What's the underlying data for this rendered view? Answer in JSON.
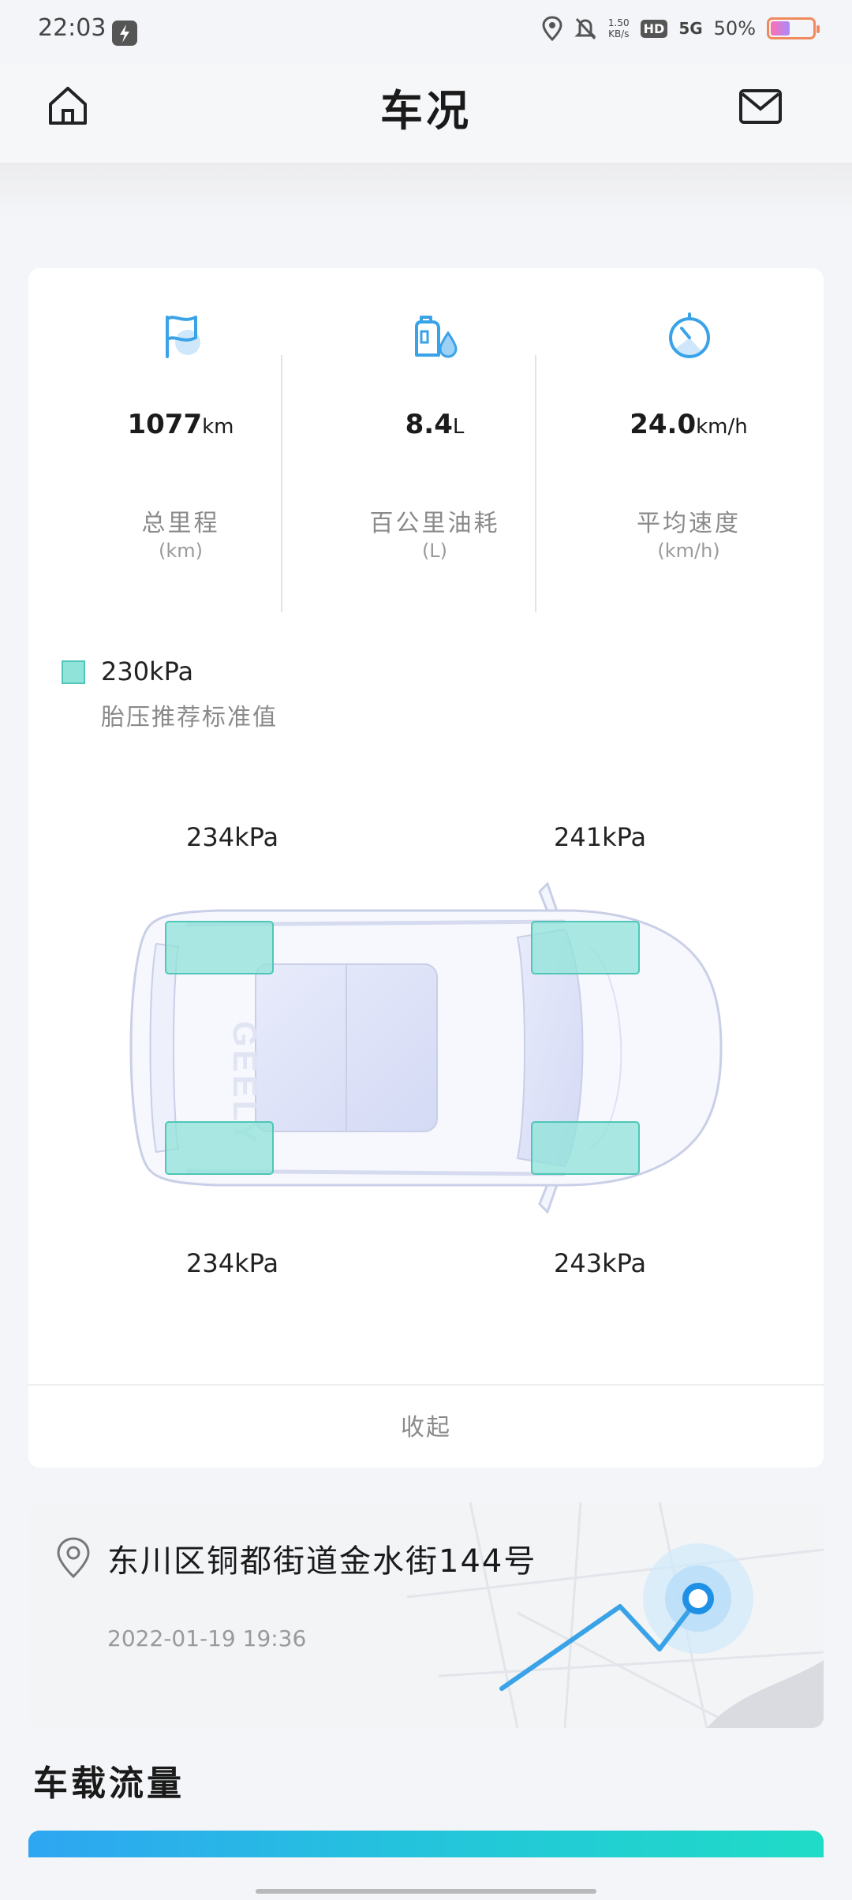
{
  "status_bar": {
    "time": "22:03",
    "net_speed_value": "1.50",
    "net_speed_unit": "KB/s",
    "hd": "HD",
    "signal": "5G",
    "battery_pct": "50%",
    "battery_level": 0.5
  },
  "header": {
    "title": "车况"
  },
  "stats": [
    {
      "value": "1077",
      "unit": "km",
      "label": "总里程",
      "sublabel": "(km)"
    },
    {
      "value": "8.4",
      "unit": "L",
      "label": "百公里油耗",
      "sublabel": "(L)"
    },
    {
      "value": "24.0",
      "unit": "km/h",
      "label": "平均速度",
      "sublabel": "(km/h)"
    }
  ],
  "tire": {
    "recommended_value": "230kPa",
    "recommended_label": "胎压推荐标准值",
    "front_left": "234kPa",
    "front_right": "241kPa",
    "rear_left": "234kPa",
    "rear_right": "243kPa",
    "car_brand": "GEELY"
  },
  "collapse_label": "收起",
  "location": {
    "address": "东川区铜都街道金水街144号",
    "time": "2022-01-19 19:36"
  },
  "traffic": {
    "title": "车载流量"
  },
  "colors": {
    "accent": "#3aa3e8",
    "tire_fill": "#8fe3d8",
    "tire_border": "#4fc6b7"
  }
}
